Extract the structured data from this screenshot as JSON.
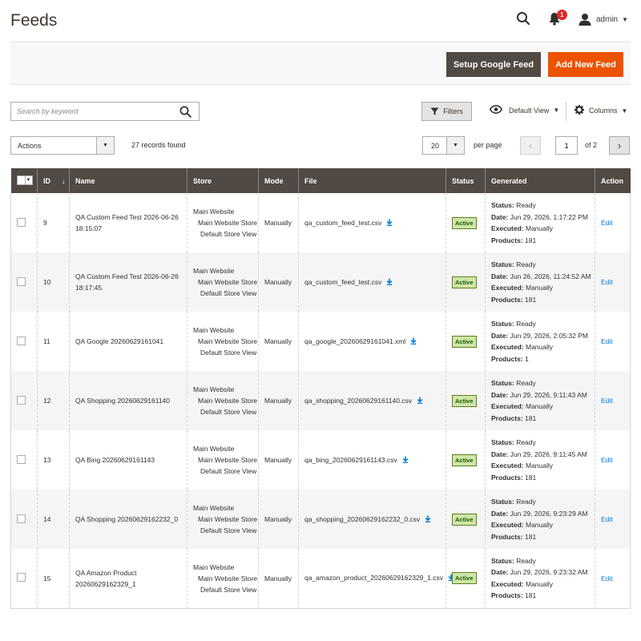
{
  "header": {
    "title": "Feeds",
    "notifications_count": "1",
    "user_name": "admin"
  },
  "toolbar": {
    "setup_google_feed": "Setup Google Feed",
    "add_new_feed": "Add New Feed"
  },
  "search": {
    "placeholder": "Search by keyword"
  },
  "controls": {
    "filters": "Filters",
    "default_view": "Default View",
    "columns": "Columns",
    "actions": "Actions",
    "records_found": "27 records found",
    "per_page_value": "20",
    "per_page_label": "per page",
    "page_current": "1",
    "page_of": "of 2"
  },
  "table": {
    "columns": [
      "ID",
      "Name",
      "Store",
      "Mode",
      "File",
      "Status",
      "Generated",
      "Action"
    ],
    "gen_labels": {
      "status": "Status:",
      "date": "Date:",
      "executed": "Executed:",
      "products": "Products:"
    },
    "rows": [
      {
        "id": "9",
        "name": "QA Custom Feed Test 2026-06-26 18:15:07",
        "store": [
          "Main Website",
          "Main Website Store",
          "Default Store View"
        ],
        "mode": "Manually",
        "file": "qa_custom_feed_test.csv",
        "status": "Active",
        "gen_status": "Ready",
        "gen_date": "Jun 29, 2026, 1:17:22 PM",
        "gen_executed": "Manually",
        "gen_products": "181",
        "action": "Edit"
      },
      {
        "id": "10",
        "name": "QA Custom Feed Test 2026-06-26 18:17:45",
        "store": [
          "Main Website",
          "Main Website Store",
          "Default Store View"
        ],
        "mode": "Manually",
        "file": "qa_custom_feed_test.csv",
        "status": "Active",
        "gen_status": "Ready",
        "gen_date": "Jun 26, 2026, 11:24:52 AM",
        "gen_executed": "Manually",
        "gen_products": "181",
        "action": "Edit"
      },
      {
        "id": "11",
        "name": "QA Google 20260629161041",
        "store": [
          "Main Website",
          "Main Website Store",
          "Default Store View"
        ],
        "mode": "Manually",
        "file": "qa_google_20260629161041.xml",
        "status": "Active",
        "gen_status": "Ready",
        "gen_date": "Jun 29, 2026, 2:05:32 PM",
        "gen_executed": "Manually",
        "gen_products": "1",
        "action": "Edit"
      },
      {
        "id": "12",
        "name": "QA Shopping 20260629161140",
        "store": [
          "Main Website",
          "Main Website Store",
          "Default Store View"
        ],
        "mode": "Manually",
        "file": "qa_shopping_20260629161140.csv",
        "status": "Active",
        "gen_status": "Ready",
        "gen_date": "Jun 29, 2026, 9:11:43 AM",
        "gen_executed": "Manually",
        "gen_products": "181",
        "action": "Edit"
      },
      {
        "id": "13",
        "name": "QA Bing 20260629161143",
        "store": [
          "Main Website",
          "Main Website Store",
          "Default Store View"
        ],
        "mode": "Manually",
        "file": "qa_bing_20260629161143.csv",
        "status": "Active",
        "gen_status": "Ready",
        "gen_date": "Jun 29, 2026, 9:11:45 AM",
        "gen_executed": "Manually",
        "gen_products": "181",
        "action": "Edit"
      },
      {
        "id": "14",
        "name": "QA Shopping 20260629162232_0",
        "store": [
          "Main Website",
          "Main Website Store",
          "Default Store View"
        ],
        "mode": "Manually",
        "file": "qa_shopping_20260629162232_0.csv",
        "status": "Active",
        "gen_status": "Ready",
        "gen_date": "Jun 29, 2026, 9:23:29 AM",
        "gen_executed": "Manually",
        "gen_products": "181",
        "action": "Edit"
      },
      {
        "id": "15",
        "name": "QA Amazon Product 20260629162329_1",
        "store": [
          "Main Website",
          "Main Website Store",
          "Default Store View"
        ],
        "mode": "Manually",
        "file": "qa_amazon_product_20260629162329_1.csv",
        "status": "Active",
        "gen_status": "Ready",
        "gen_date": "Jun 29, 2026, 9:23:32 AM",
        "gen_executed": "Manually",
        "gen_products": "181",
        "action": "Edit"
      }
    ]
  },
  "colors": {
    "header_bg": "#514943",
    "primary_orange": "#eb5202",
    "link_blue": "#007bdb",
    "active_badge_bg": "#d0e5a9"
  },
  "icons": {
    "search": "search-icon",
    "bell": "bell-icon",
    "user": "user-icon",
    "filter": "filter-icon",
    "eye": "eye-icon",
    "gear": "gear-icon",
    "download": "download-icon"
  }
}
